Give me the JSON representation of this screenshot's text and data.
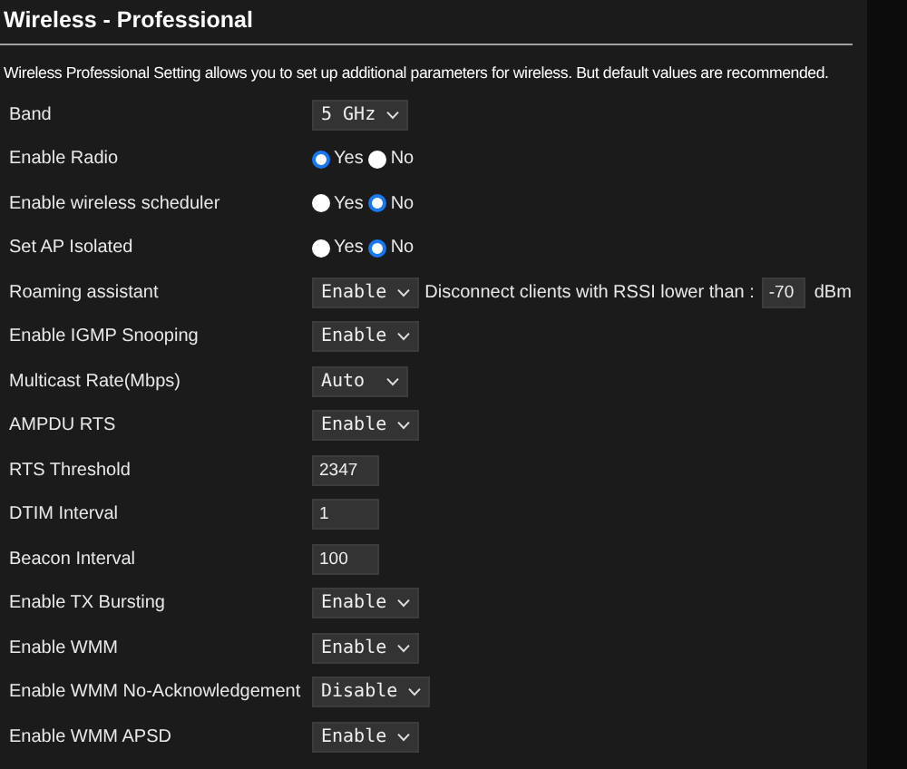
{
  "title": "Wireless - Professional",
  "description": "Wireless Professional Setting allows you to set up additional parameters for wireless. But default values are recommended.",
  "rows": [
    {
      "label": "Band",
      "kind": "select",
      "value": "5 GHz"
    },
    {
      "label": "Enable Radio",
      "kind": "radio",
      "options": [
        {
          "label": "Yes",
          "selected": true
        },
        {
          "label": "No",
          "selected": false
        }
      ]
    },
    {
      "label": "Enable wireless scheduler",
      "kind": "radio",
      "options": [
        {
          "label": "Yes",
          "selected": false
        },
        {
          "label": "No",
          "selected": true
        }
      ]
    },
    {
      "label": "Set AP Isolated",
      "kind": "radio",
      "options": [
        {
          "label": "Yes",
          "selected": false
        },
        {
          "label": "No",
          "selected": true
        }
      ]
    },
    {
      "label": "Roaming assistant",
      "kind": "select",
      "value": "Enable",
      "extra": {
        "text": "Disconnect clients with RSSI lower than :",
        "value": "-70",
        "unit": "dBm"
      }
    },
    {
      "label": "Enable IGMP Snooping",
      "kind": "select",
      "value": "Enable"
    },
    {
      "label": "Multicast Rate(Mbps)",
      "kind": "select",
      "value": "Auto"
    },
    {
      "label": "AMPDU RTS",
      "kind": "select",
      "value": "Enable"
    },
    {
      "label": "RTS Threshold",
      "kind": "input",
      "value": "2347"
    },
    {
      "label": "DTIM Interval",
      "kind": "input",
      "value": "1"
    },
    {
      "label": "Beacon Interval",
      "kind": "input",
      "value": "100"
    },
    {
      "label": "Enable TX Bursting",
      "kind": "select",
      "value": "Enable"
    },
    {
      "label": "Enable WMM",
      "kind": "select",
      "value": "Enable"
    },
    {
      "label": "Enable WMM No-Acknowledgement",
      "kind": "select",
      "value": "Disable"
    },
    {
      "label": "Enable WMM APSD",
      "kind": "select",
      "value": "Enable"
    }
  ]
}
